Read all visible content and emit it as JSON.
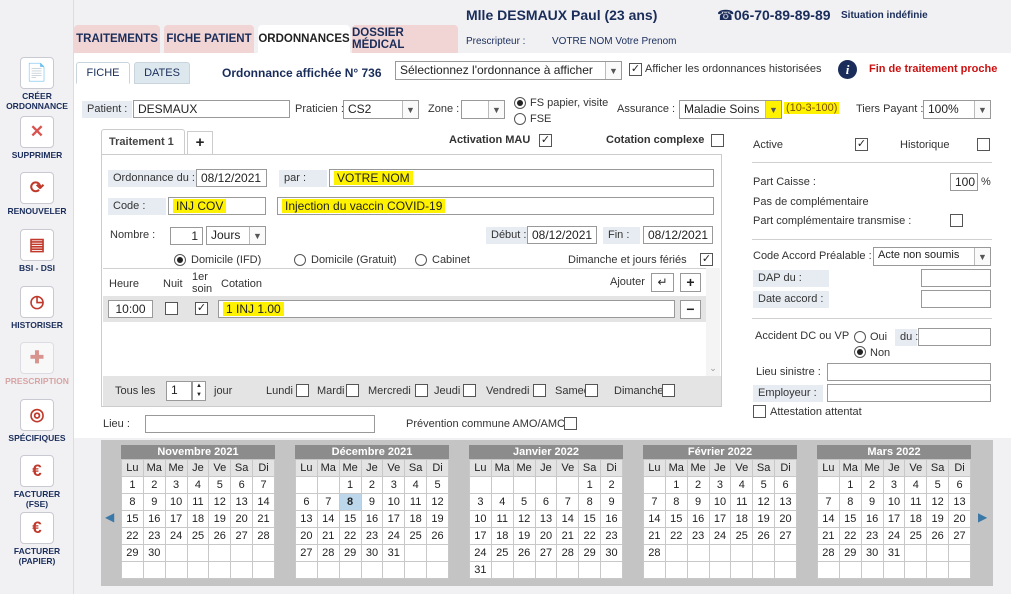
{
  "sidebar": [
    {
      "label": "CRÉER ORDONNANCE",
      "icon": "document-add-icon"
    },
    {
      "label": "SUPPRIMER",
      "icon": "delete-icon"
    },
    {
      "label": "RENOUVELER",
      "icon": "renew-icon"
    },
    {
      "label": "BSI - DSI",
      "icon": "documents-icon"
    },
    {
      "label": "HISTORISER",
      "icon": "clock-icon"
    },
    {
      "label": "PRESCRIPTION",
      "icon": "prescription-icon"
    },
    {
      "label": "SPÉCIFIQUES",
      "icon": "target-icon"
    },
    {
      "label": "FACTURER (FSE)",
      "icon": "euro-stars-icon"
    },
    {
      "label": "FACTURER (PAPIER)",
      "icon": "euro-doc-icon"
    }
  ],
  "header": {
    "patient": "Mlle DESMAUX Paul (23 ans)",
    "phone": "06-70-89-89-89",
    "situation": "Situation indéfinie",
    "prescripteur_label": "Prescripteur :",
    "prescripteur": "VOTRE NOM Votre Prenom"
  },
  "tabs": [
    "TRAITEMENTS",
    "FICHE PATIENT",
    "ORDONNANCES",
    "DOSSIER MÉDICAL"
  ],
  "subtabs": [
    "FICHE",
    "DATES"
  ],
  "ordo": {
    "title": "Ordonnance affichée N° 736",
    "select": "Sélectionnez l'ordonnance à afficher",
    "hist": "Afficher les ordonnances historisées",
    "alert": "Fin de traitement proche"
  },
  "row1": {
    "patient_label": "Patient :",
    "patient": "DESMAUX",
    "praticien_label": "Praticien :",
    "praticien": "CS2",
    "zone_label": "Zone :",
    "zone": "",
    "fs_papier": "FS papier, visite",
    "fse": "FSE",
    "assurance_label": "Assurance :",
    "assurance": "Maladie Soins",
    "assurance_code": "(10-3-100)",
    "tiers_label": "Tiers Payant :",
    "tiers": "100%"
  },
  "traitement": {
    "tab": "Traitement 1",
    "add": "+",
    "mau": "Activation MAU",
    "cotation_complexe": "Cotation complexe",
    "ordo_du_label": "Ordonnance du :",
    "ordo_du": "08/12/2021",
    "par_label": "par :",
    "par": "VOTRE NOM",
    "code_label": "Code :",
    "code": "INJ COV",
    "code_desc": "Injection du vaccin COVID-19",
    "nombre_label": "Nombre :",
    "nombre": "1",
    "unite": "Jours",
    "debut_label": "Début :",
    "debut": "08/12/2021",
    "fin_label": "Fin :",
    "fin": "08/12/2021",
    "dom_ifd": "Domicile (IFD)",
    "dom_gratuit": "Domicile (Gratuit)",
    "cabinet": "Cabinet",
    "dimanche": "Dimanche et jours fériés",
    "col_heure": "Heure",
    "col_nuit": "Nuit",
    "col_soin": "1er soin",
    "col_cotation": "Cotation",
    "ajouter": "Ajouter",
    "heure": "10:00",
    "cotation": "1 INJ 1.00",
    "tous_les": "Tous les",
    "tous_val": "1",
    "jour": "jour",
    "days": [
      "Lundi",
      "Mardi",
      "Mercredi",
      "Jeudi",
      "Vendredi",
      "Samedi",
      "Dimanche"
    ],
    "lieu_label": "Lieu :",
    "prevention": "Prévention commune AMO/AMC"
  },
  "right": {
    "active": "Active",
    "historique": "Historique",
    "part_caisse_label": "Part Caisse :",
    "part_caisse": "100",
    "pct": "%",
    "pas_comp": "Pas de complémentaire",
    "part_comp": "Part complémentaire transmise :",
    "code_accord_label": "Code Accord Préalable :",
    "code_accord": "Acte non soumis",
    "dap_label": "DAP du :",
    "date_accord_label": "Date accord :",
    "accident_label": "Accident DC ou VP",
    "oui": "Oui",
    "non": "Non",
    "du_label": "du :",
    "lieu_sinistre_label": "Lieu sinistre :",
    "employeur_label": "Employeur :",
    "attestation": "Attestation attentat"
  },
  "calendar": {
    "weekdays": [
      "Lu",
      "Ma",
      "Me",
      "Je",
      "Ve",
      "Sa",
      "Di"
    ],
    "months": [
      {
        "name": "Novembre 2021",
        "start": 0,
        "days": 30
      },
      {
        "name": "Décembre 2021",
        "start": 2,
        "days": 31,
        "today": 8
      },
      {
        "name": "Janvier 2022",
        "start": 5,
        "days": 31
      },
      {
        "name": "Février 2022",
        "start": 1,
        "days": 28
      },
      {
        "name": "Mars 2022",
        "start": 1,
        "days": 31
      }
    ]
  }
}
